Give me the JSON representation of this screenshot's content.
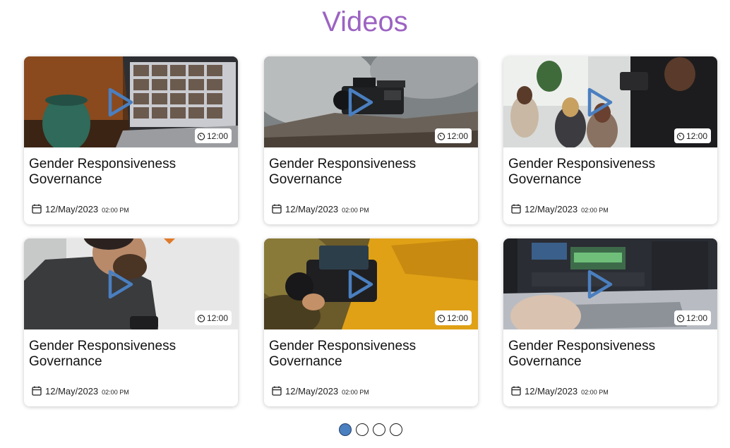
{
  "page": {
    "title": "Videos",
    "accent_color": "#9c63c3"
  },
  "icons": {
    "play": "play-icon",
    "duration": "timer-icon",
    "date": "calendar-icon"
  },
  "cards": [
    {
      "title": "Gender Responsiveness Governance",
      "duration": "12:00",
      "date": "12/May/2023",
      "time": "02:00 PM",
      "scene": "video-call-laptop"
    },
    {
      "title": "Gender Responsiveness Governance",
      "duration": "12:00",
      "date": "12/May/2023",
      "time": "02:00 PM",
      "scene": "cinema-camera"
    },
    {
      "title": "Gender Responsiveness Governance",
      "duration": "12:00",
      "date": "12/May/2023",
      "time": "02:00 PM",
      "scene": "filming-audience"
    },
    {
      "title": "Gender Responsiveness Governance",
      "duration": "12:00",
      "date": "12/May/2023",
      "time": "02:00 PM",
      "scene": "man-with-camera"
    },
    {
      "title": "Gender Responsiveness Governance",
      "duration": "12:00",
      "date": "12/May/2023",
      "time": "02:00 PM",
      "scene": "camera-closeup"
    },
    {
      "title": "Gender Responsiveness Governance",
      "duration": "12:00",
      "date": "12/May/2023",
      "time": "02:00 PM",
      "scene": "video-editing-laptop"
    }
  ],
  "pagination": {
    "pages": 4,
    "active": 1,
    "active_color": "#4a7fc0"
  }
}
